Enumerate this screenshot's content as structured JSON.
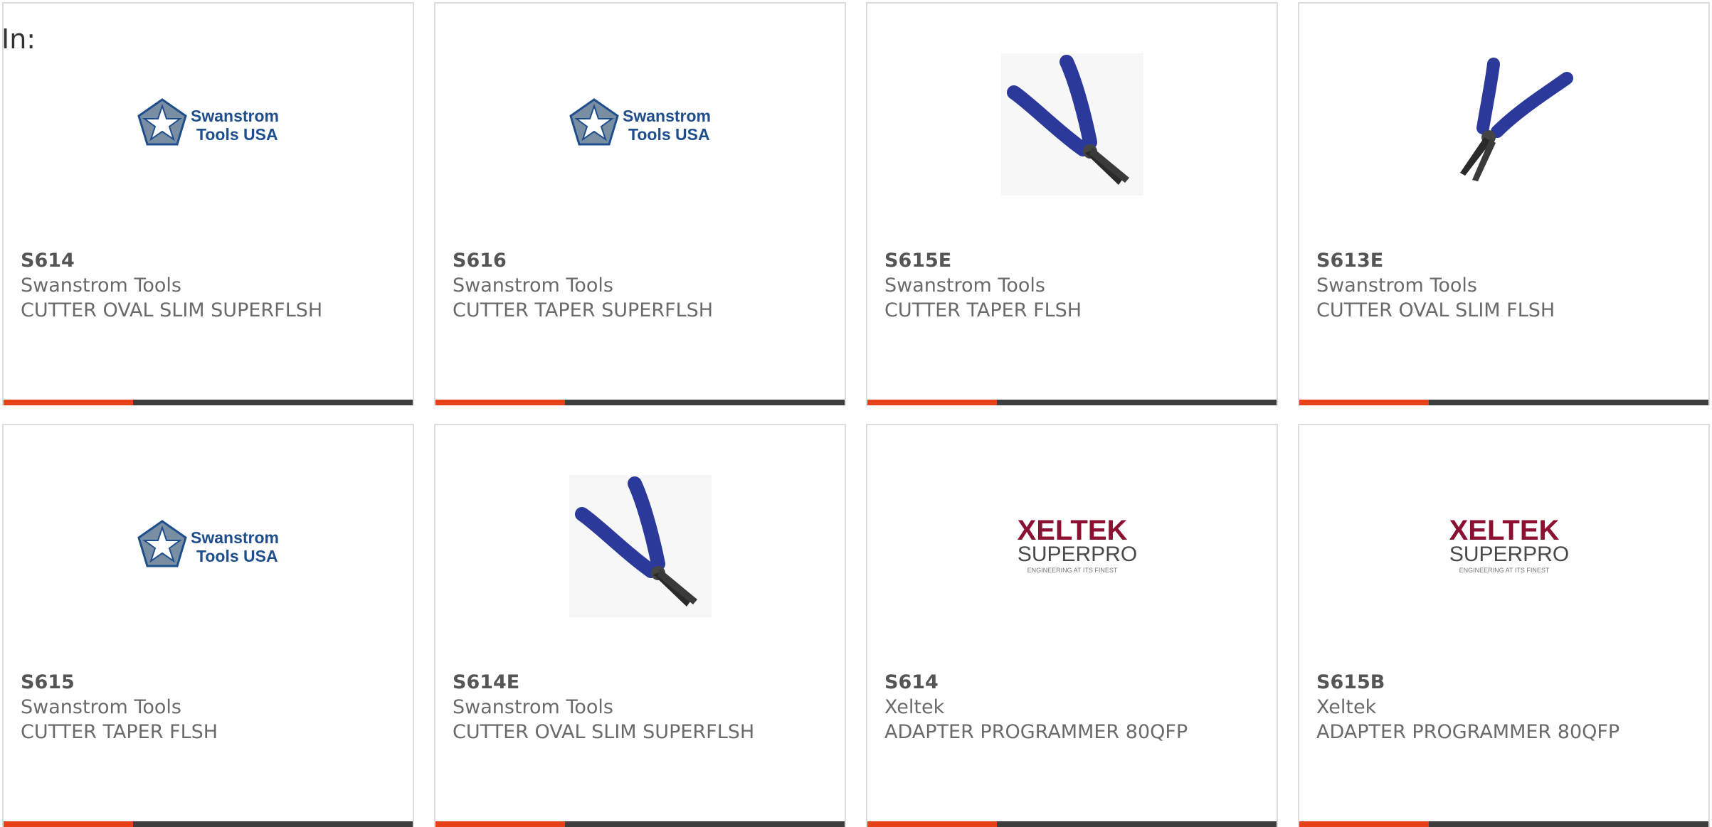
{
  "header": {
    "label": "In:"
  },
  "colors": {
    "accent": "#e64119",
    "bar": "#3d3d3d",
    "swanstrom_blue": "#1f4e8c",
    "xeltek_red": "#8c1032"
  },
  "products": [
    {
      "part": "S614",
      "maker": "Swanstrom Tools",
      "desc": "CUTTER OVAL SLIM SUPERFLSH",
      "image": "swanstrom-logo",
      "logo_line1": "Swanstrom",
      "logo_line2": "Tools USA"
    },
    {
      "part": "S616",
      "maker": "Swanstrom Tools",
      "desc": "CUTTER TAPER SUPERFLSH",
      "image": "swanstrom-logo",
      "logo_line1": "Swanstrom",
      "logo_line2": "Tools USA"
    },
    {
      "part": "S615E",
      "maker": "Swanstrom Tools",
      "desc": "CUTTER TAPER FLSH",
      "image": "cutter-pliers-photo"
    },
    {
      "part": "S613E",
      "maker": "Swanstrom Tools",
      "desc": "CUTTER OVAL SLIM FLSH",
      "image": "cutter-pliers-photo"
    },
    {
      "part": "S615",
      "maker": "Swanstrom Tools",
      "desc": "CUTTER TAPER FLSH",
      "image": "swanstrom-logo",
      "logo_line1": "Swanstrom",
      "logo_line2": "Tools USA"
    },
    {
      "part": "S614E",
      "maker": "Swanstrom Tools",
      "desc": "CUTTER OVAL SLIM SUPERFLSH",
      "image": "cutter-pliers-photo"
    },
    {
      "part": "S614",
      "maker": "Xeltek",
      "desc": "ADAPTER PROGRAMMER 80QFP",
      "image": "xeltek-logo",
      "logo_line1": "XELTEK",
      "logo_line2": "SUPERPRO",
      "logo_tagline": "ENGINEERING AT ITS FINEST"
    },
    {
      "part": "S615B",
      "maker": "Xeltek",
      "desc": "ADAPTER PROGRAMMER 80QFP",
      "image": "xeltek-logo",
      "logo_line1": "XELTEK",
      "logo_line2": "SUPERPRO",
      "logo_tagline": "ENGINEERING AT ITS FINEST"
    }
  ]
}
